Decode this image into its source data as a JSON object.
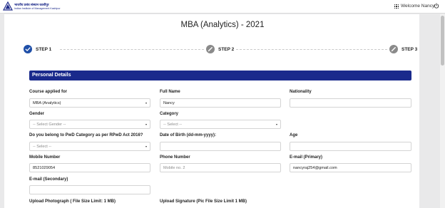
{
  "header": {
    "logo_hindi": "भारतीय प्रबंध संस्थान काशीपुर",
    "logo_english": "Indian Institute of Management Kashipur",
    "welcome_text": "Welcome Nancy",
    "apps_icon": "grid-icon",
    "logout_icon": "power-icon"
  },
  "page": {
    "title": "MBA (Analytics) - 2021"
  },
  "steps": [
    {
      "label": "STEP 1",
      "state": "completed",
      "icon": "check-icon"
    },
    {
      "label": "STEP 2",
      "state": "pending",
      "icon": "pencil-icon"
    },
    {
      "label": "STEP 3",
      "state": "pending",
      "icon": "pencil-icon"
    }
  ],
  "section": {
    "title": "Personal Details"
  },
  "form": {
    "course": {
      "label": "Course applied for",
      "value": "MBA (Analytics)"
    },
    "full_name": {
      "label": "Full Name",
      "value": "Nancy"
    },
    "nationality": {
      "label": "Nationality",
      "value": ""
    },
    "gender": {
      "label": "Gender",
      "value": "-- Select Gender --"
    },
    "category": {
      "label": "Category",
      "value": "-- Select --"
    },
    "pwd": {
      "label": "Do you belong to PwD Category as per RPwD Act 2016?",
      "value": "-- Select --"
    },
    "dob": {
      "label": "Date of Birth (dd-mm-yyyy):",
      "value": ""
    },
    "age": {
      "label": "Age",
      "value": ""
    },
    "mobile": {
      "label": "Mobile Number",
      "value": "8521029054"
    },
    "phone": {
      "label": "Phone Number",
      "placeholder": "Mobile no. 2"
    },
    "email_primary": {
      "label": "E-mail (Primary)",
      "value": "nancyraj254@gmail.com"
    },
    "email_secondary": {
      "label": "E-mail (Secondary)",
      "value": ""
    },
    "photo": {
      "label": "Upload Photograph ( File Size Limit: 1 MB)"
    },
    "signature": {
      "label": "Upload Signature (Pic File Size Limit 1 MB)"
    }
  },
  "colors": {
    "brand": "#1a2a8c",
    "step_active": "#1f4fa8",
    "step_pending": "#8a8a8a"
  }
}
